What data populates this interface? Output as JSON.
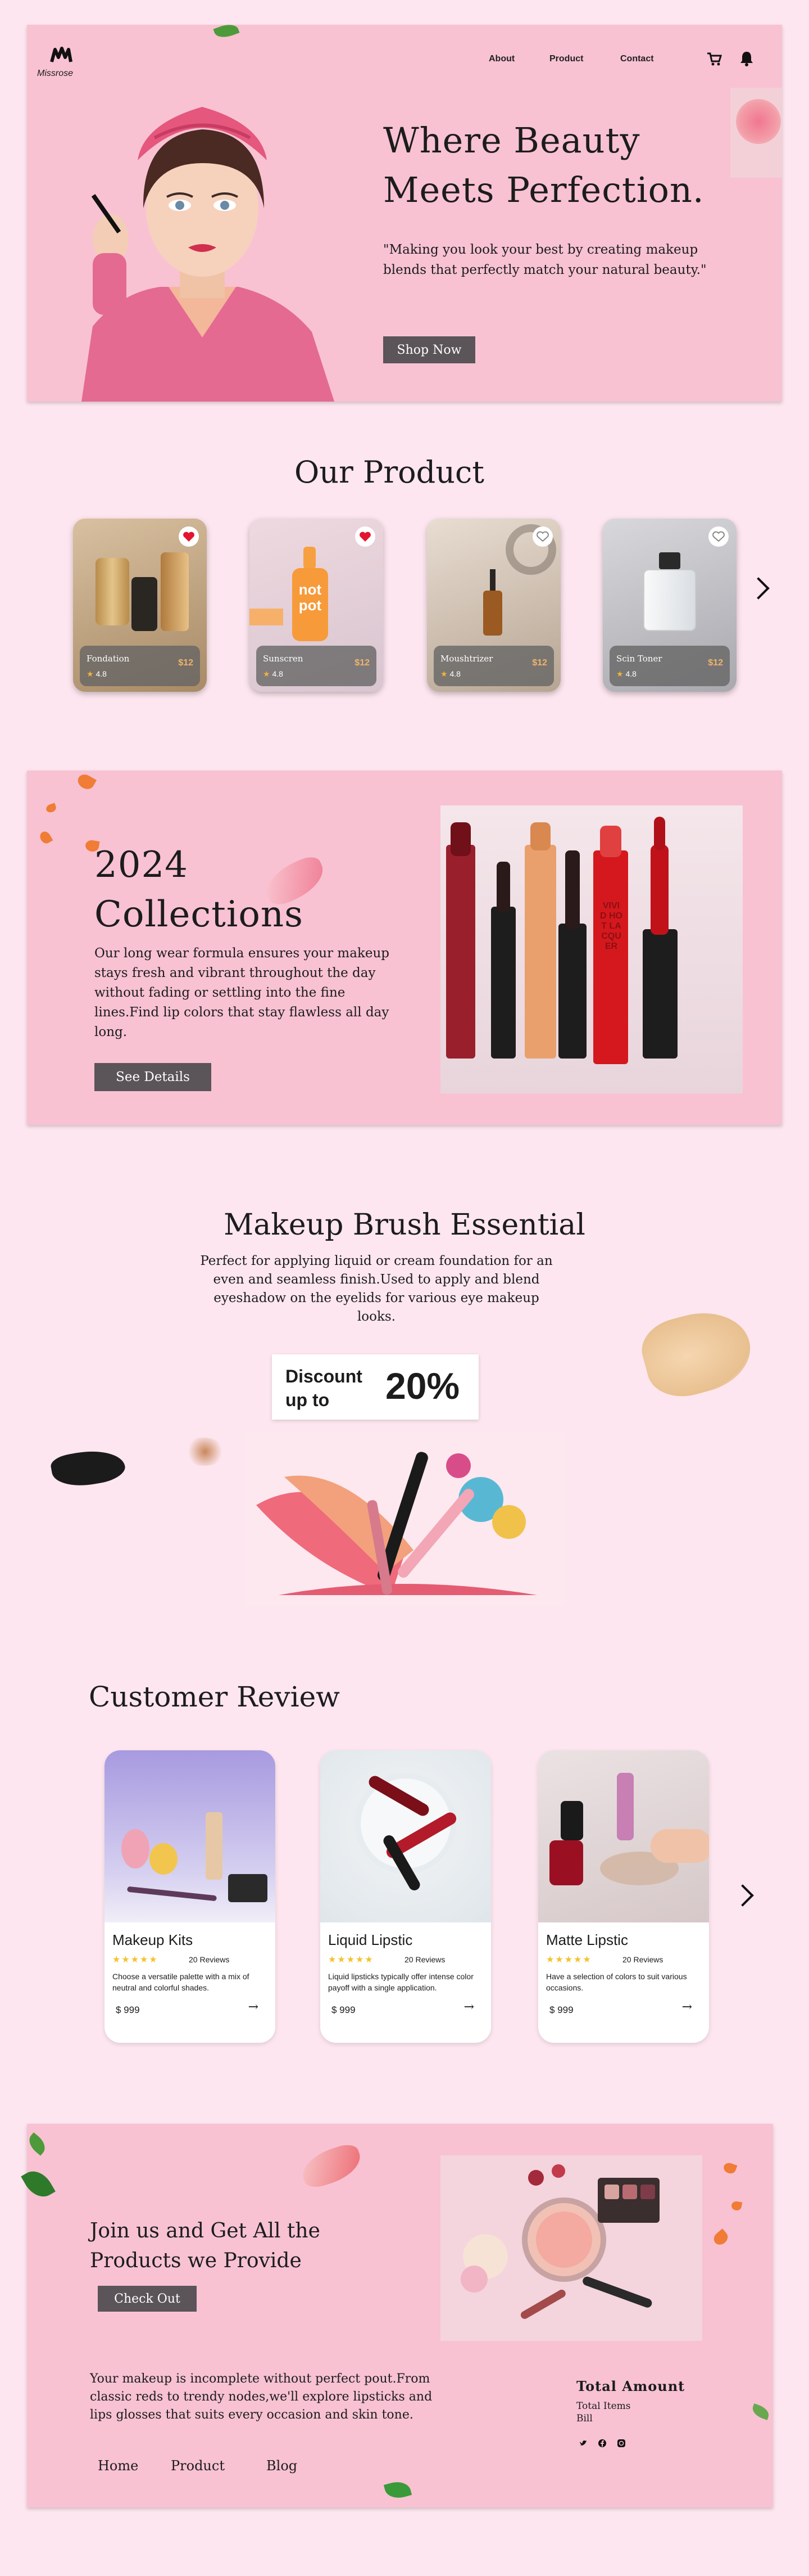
{
  "brand": {
    "name": "Missrose"
  },
  "nav": {
    "about": "About",
    "product": "Product",
    "contact": "Contact",
    "icons": [
      "cart-icon",
      "bell-icon"
    ]
  },
  "hero": {
    "title_line1": "Where Beauty",
    "title_line2": "Meets Perfection.",
    "quote": "\"Making you look your best by creating makeup blends that perfectly match your natural beauty.\"",
    "cta": "Shop Now"
  },
  "products": {
    "heading": "Our Product",
    "items": [
      {
        "name": "Fondation",
        "price": "$12",
        "rating": "4.8",
        "favorited": true,
        "icon": "foundation-bottles-image"
      },
      {
        "name": "Sunscren",
        "price": "$12",
        "rating": "4.8",
        "favorited": true,
        "icon": "sunscreen-bottle-image"
      },
      {
        "name": "Moushtrizer",
        "price": "$12",
        "rating": "4.8",
        "favorited": false,
        "icon": "moisturizer-dropper-image"
      },
      {
        "name": "Scin Toner",
        "price": "$12",
        "rating": "4.8",
        "favorited": false,
        "icon": "toner-bottle-image"
      }
    ]
  },
  "collections": {
    "title_line1": "2024",
    "title_line2": "Collections",
    "body": "Our long wear formula ensures  your makeup stays fresh and vibrant throughout the day without fading or settling into the fine lines.Find lip colors that stay flawless all day long.",
    "cta": "See Details",
    "tube_text": "VIVID HOT LACQUER"
  },
  "brush": {
    "title": "Makeup Brush Essential",
    "body": "Perfect for applying liquid or cream foundation for an even and seamless finish.Used to apply and blend eyeshadow on the eyelids for various eye makeup looks.",
    "discount_label_1": "Discount",
    "discount_label_2": "up to",
    "discount_value": "20%"
  },
  "reviews": {
    "heading": "Customer Review",
    "items": [
      {
        "name": "Makeup Kits",
        "stars": "★★★★★",
        "count": "20 Reviews",
        "desc": "Choose a versatile palette with a mix of neutral and colorful shades.",
        "price": "$ 999"
      },
      {
        "name": "Liquid Lipstic",
        "stars": "★★★★★",
        "count": "20 Reviews",
        "desc": "Liquid lipsticks typically offer intense color payoff with a single application.",
        "price": "$ 999"
      },
      {
        "name": "Matte Lipstic",
        "stars": "★★★★★",
        "count": "20 Reviews",
        "desc": "Have a selection of colors to suit various occasions.",
        "price": "$ 999"
      }
    ]
  },
  "footer": {
    "title_line1": "Join us and Get All the",
    "title_line2": "Products we Provide",
    "cta": "Check Out",
    "body": "Your makeup is incomplete without perfect pout.From classic reds to trendy nodes,we'll explore lipsticks and lips glosses that suits every occasion and skin tone.",
    "links": [
      "Home",
      "Product",
      "Blog"
    ],
    "total_title": "Total Amount",
    "total_items": "Total Items",
    "bill": "Bill",
    "social_icons": [
      "twitter-icon",
      "facebook-icon",
      "instagram-icon"
    ]
  },
  "colors": {
    "page_bg": "#fde6ef",
    "panel_bg": "#f8c2d3",
    "button": "#5b5458",
    "heart_red": "#e4142f",
    "price_gold": "#f0b36a",
    "star_yellow": "#f3c22d"
  }
}
